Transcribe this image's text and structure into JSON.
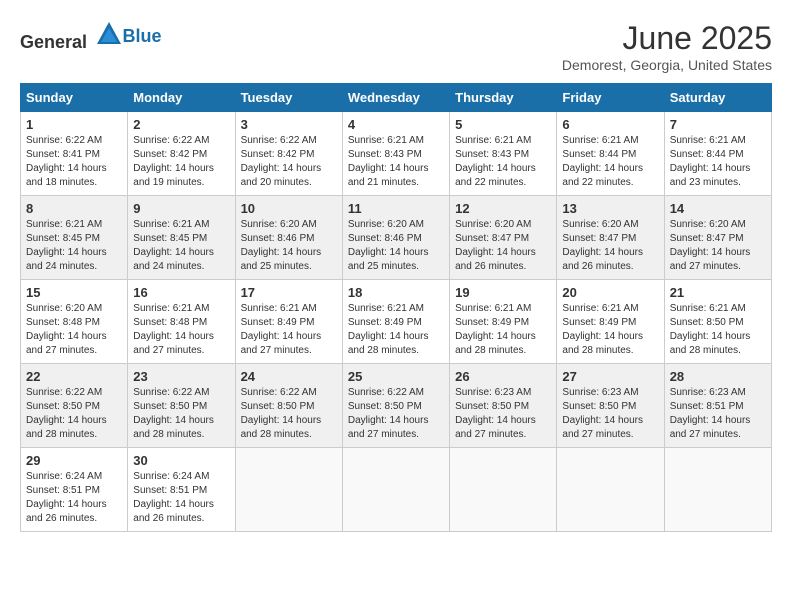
{
  "header": {
    "logo_general": "General",
    "logo_blue": "Blue",
    "month": "June 2025",
    "location": "Demorest, Georgia, United States"
  },
  "days_of_week": [
    "Sunday",
    "Monday",
    "Tuesday",
    "Wednesday",
    "Thursday",
    "Friday",
    "Saturday"
  ],
  "weeks": [
    [
      {
        "day": "1",
        "info": "Sunrise: 6:22 AM\nSunset: 8:41 PM\nDaylight: 14 hours\nand 18 minutes."
      },
      {
        "day": "2",
        "info": "Sunrise: 6:22 AM\nSunset: 8:42 PM\nDaylight: 14 hours\nand 19 minutes."
      },
      {
        "day": "3",
        "info": "Sunrise: 6:22 AM\nSunset: 8:42 PM\nDaylight: 14 hours\nand 20 minutes."
      },
      {
        "day": "4",
        "info": "Sunrise: 6:21 AM\nSunset: 8:43 PM\nDaylight: 14 hours\nand 21 minutes."
      },
      {
        "day": "5",
        "info": "Sunrise: 6:21 AM\nSunset: 8:43 PM\nDaylight: 14 hours\nand 22 minutes."
      },
      {
        "day": "6",
        "info": "Sunrise: 6:21 AM\nSunset: 8:44 PM\nDaylight: 14 hours\nand 22 minutes."
      },
      {
        "day": "7",
        "info": "Sunrise: 6:21 AM\nSunset: 8:44 PM\nDaylight: 14 hours\nand 23 minutes."
      }
    ],
    [
      {
        "day": "8",
        "info": "Sunrise: 6:21 AM\nSunset: 8:45 PM\nDaylight: 14 hours\nand 24 minutes."
      },
      {
        "day": "9",
        "info": "Sunrise: 6:21 AM\nSunset: 8:45 PM\nDaylight: 14 hours\nand 24 minutes."
      },
      {
        "day": "10",
        "info": "Sunrise: 6:20 AM\nSunset: 8:46 PM\nDaylight: 14 hours\nand 25 minutes."
      },
      {
        "day": "11",
        "info": "Sunrise: 6:20 AM\nSunset: 8:46 PM\nDaylight: 14 hours\nand 25 minutes."
      },
      {
        "day": "12",
        "info": "Sunrise: 6:20 AM\nSunset: 8:47 PM\nDaylight: 14 hours\nand 26 minutes."
      },
      {
        "day": "13",
        "info": "Sunrise: 6:20 AM\nSunset: 8:47 PM\nDaylight: 14 hours\nand 26 minutes."
      },
      {
        "day": "14",
        "info": "Sunrise: 6:20 AM\nSunset: 8:47 PM\nDaylight: 14 hours\nand 27 minutes."
      }
    ],
    [
      {
        "day": "15",
        "info": "Sunrise: 6:20 AM\nSunset: 8:48 PM\nDaylight: 14 hours\nand 27 minutes."
      },
      {
        "day": "16",
        "info": "Sunrise: 6:21 AM\nSunset: 8:48 PM\nDaylight: 14 hours\nand 27 minutes."
      },
      {
        "day": "17",
        "info": "Sunrise: 6:21 AM\nSunset: 8:49 PM\nDaylight: 14 hours\nand 27 minutes."
      },
      {
        "day": "18",
        "info": "Sunrise: 6:21 AM\nSunset: 8:49 PM\nDaylight: 14 hours\nand 28 minutes."
      },
      {
        "day": "19",
        "info": "Sunrise: 6:21 AM\nSunset: 8:49 PM\nDaylight: 14 hours\nand 28 minutes."
      },
      {
        "day": "20",
        "info": "Sunrise: 6:21 AM\nSunset: 8:49 PM\nDaylight: 14 hours\nand 28 minutes."
      },
      {
        "day": "21",
        "info": "Sunrise: 6:21 AM\nSunset: 8:50 PM\nDaylight: 14 hours\nand 28 minutes."
      }
    ],
    [
      {
        "day": "22",
        "info": "Sunrise: 6:22 AM\nSunset: 8:50 PM\nDaylight: 14 hours\nand 28 minutes."
      },
      {
        "day": "23",
        "info": "Sunrise: 6:22 AM\nSunset: 8:50 PM\nDaylight: 14 hours\nand 28 minutes."
      },
      {
        "day": "24",
        "info": "Sunrise: 6:22 AM\nSunset: 8:50 PM\nDaylight: 14 hours\nand 28 minutes."
      },
      {
        "day": "25",
        "info": "Sunrise: 6:22 AM\nSunset: 8:50 PM\nDaylight: 14 hours\nand 27 minutes."
      },
      {
        "day": "26",
        "info": "Sunrise: 6:23 AM\nSunset: 8:50 PM\nDaylight: 14 hours\nand 27 minutes."
      },
      {
        "day": "27",
        "info": "Sunrise: 6:23 AM\nSunset: 8:50 PM\nDaylight: 14 hours\nand 27 minutes."
      },
      {
        "day": "28",
        "info": "Sunrise: 6:23 AM\nSunset: 8:51 PM\nDaylight: 14 hours\nand 27 minutes."
      }
    ],
    [
      {
        "day": "29",
        "info": "Sunrise: 6:24 AM\nSunset: 8:51 PM\nDaylight: 14 hours\nand 26 minutes."
      },
      {
        "day": "30",
        "info": "Sunrise: 6:24 AM\nSunset: 8:51 PM\nDaylight: 14 hours\nand 26 minutes."
      },
      {
        "day": "",
        "info": ""
      },
      {
        "day": "",
        "info": ""
      },
      {
        "day": "",
        "info": ""
      },
      {
        "day": "",
        "info": ""
      },
      {
        "day": "",
        "info": ""
      }
    ]
  ]
}
